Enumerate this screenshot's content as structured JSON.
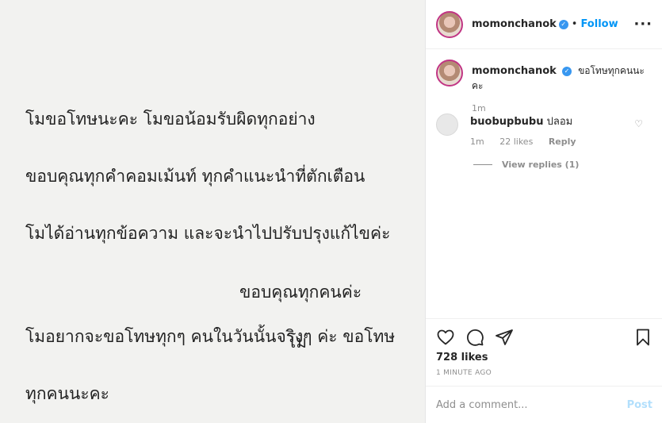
{
  "media": {
    "paragraph1": [
      "โมขอโทษนะคะ โมขอน้อมรับผิดทุกอย่าง",
      "ขอบคุณทุกคำคอมเม้นท์ ทุกคำแนะนำที่ตักเตือน",
      "โมได้อ่านทุกข้อความ และจะนำไปปรับปรุงแก้ไขค่ะ"
    ],
    "paragraph2": [
      "โมอยากจะขอโทษทุกๆ คนในวันนั้นจริงๆ ค่ะ ขอโทษ",
      "ทุกคนนะคะ"
    ],
    "thanks": "ขอบคุณทุกคนค่ะ",
    "signature": "โม"
  },
  "header": {
    "username": "momonchanok",
    "verified_icon": "verified-badge-icon",
    "dot": "•",
    "follow_label": "Follow",
    "more_label": "···"
  },
  "caption": {
    "username": "momonchanok",
    "text": "ขอโทษทุกคนนะคะ",
    "time": "1m"
  },
  "comment": {
    "username": "buobupbubu",
    "text": "ปลอม",
    "time": "1m",
    "likes": "22 likes",
    "reply_label": "Reply",
    "view_replies": "View replies (1)"
  },
  "footer": {
    "likes": "728 likes",
    "ago": "1 MINUTE AGO",
    "comment_placeholder": "Add a comment...",
    "post_label": "Post"
  },
  "colors": {
    "accent": "#0095f6",
    "post_disabled": "#b2dffc",
    "muted": "#8e8e8e",
    "story_ring": "#c13584"
  }
}
